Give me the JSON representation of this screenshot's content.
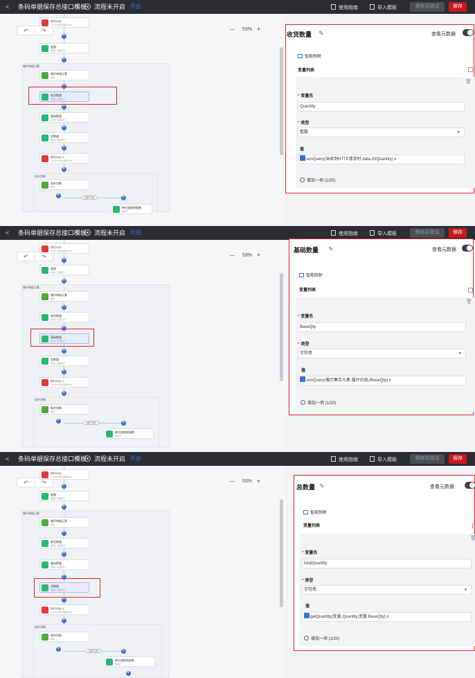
{
  "app": {
    "back_icon": "chevron-left-icon",
    "title": "条码单据保存总接口模板",
    "status": "流程未开启",
    "open_link": "开启",
    "guide": "使用指南",
    "import": "导入模板",
    "save_test": "保存并测试",
    "save": "保存",
    "zoom": "53%",
    "zoom_minus": "—",
    "zoom_plus": "+",
    "undo": "↶",
    "redo": "↷",
    "accent": "#3a6fd8",
    "save_color": "#c8191f"
  },
  "flow": {
    "node_a_title": "执行SQL",
    "node_a_sub": "JsonPath对应编码SWF...",
    "node_var": "变量",
    "node_var_sub": "变量计·变量定义",
    "loop_group": "循环单据元素",
    "loop_node": "循环单据元素",
    "loop_node_sub": "结束",
    "recv_node": "收货数量",
    "recv_sub": "变量计·变量定义",
    "base_node": "基础数量",
    "base_sub": "变量计·变量定义",
    "total_node": "总数量",
    "total_sub": "变量计·变量定义",
    "exec_node": "执行SQL-1",
    "exec_sub": "JsonPath对应编码SWF...",
    "cond_group": "条件判断",
    "cond_node": "条件判断",
    "cond_sub": "成功",
    "branch_label": "如果不满足",
    "final_node": "单位变换依据数",
    "final_sub": "变量计"
  },
  "panels": [
    {
      "title": "收货数量",
      "meta_label": "查看元数据",
      "smart_map": "智能映射",
      "var_list": "变量列表",
      "name_label": "变量名",
      "name_value": "Quantity",
      "type_label": "类型",
      "type_value": "整数",
      "value_label": "值",
      "value_expr": "sonQuery(当收到HTTP请求时.data,/0/Quantity) x",
      "add_label": "增加一项 (1/20)"
    },
    {
      "title": "基础数量",
      "meta_label": "查看元数据",
      "smart_map": "智能映射",
      "var_list": "变量列表",
      "name_label": "变量名",
      "name_value": "BaseQty",
      "type_label": "类型",
      "type_value": "字符串",
      "value_label": "值",
      "value_expr": "sonQuery(循历集合元素.循环内容,/BaseQty) x",
      "add_label": "增加一项 (1/20)"
    },
    {
      "title": "总数量",
      "meta_label": "查看元数据",
      "smart_map": "智能映射",
      "var_list": "变量列表",
      "name_label": "变量名",
      "name_value": "totalQuantity",
      "type_label": "类型",
      "type_value": "字符串",
      "value_label": "值",
      "value_expr": "getQuantity(变量.Quantity,变量.BaseQty) x",
      "add_label": "增加一项 (1/20)"
    }
  ]
}
